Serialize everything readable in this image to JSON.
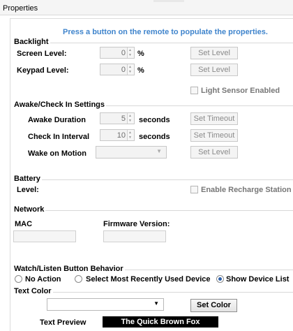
{
  "tab": {
    "title": "Properties"
  },
  "hint": "Press a button on the remote to populate the properties.",
  "backlight": {
    "title": "Backlight",
    "screen_label": "Screen Level:",
    "screen_value": "0",
    "screen_unit": "%",
    "keypad_label": "Keypad Level:",
    "keypad_value": "0",
    "keypad_unit": "%",
    "set_level_label": "Set Level",
    "light_sensor_label": "Light Sensor Enabled"
  },
  "awake": {
    "title": "Awake/Check In Settings",
    "awake_label": "Awake Duration",
    "awake_value": "5",
    "awake_unit": "seconds",
    "checkin_label": "Check In Interval",
    "checkin_value": "10",
    "checkin_unit": "seconds",
    "set_timeout_label": "Set Timeout",
    "wake_label": "Wake on Motion",
    "set_level_label": "Set Level"
  },
  "battery": {
    "title": "Battery",
    "level_label": "Level:",
    "recharge_label": "Enable Recharge Station"
  },
  "network": {
    "title": "Network",
    "mac_label": "MAC",
    "firmware_label": "Firmware Version:"
  },
  "watch": {
    "title": "Watch/Listen Button Behavior",
    "opt_none": "No Action",
    "opt_recent": "Select Most Recently Used Device",
    "opt_list": "Show Device List",
    "selected": "Show Device List"
  },
  "text_color": {
    "title": "Text Color",
    "set_color_label": "Set Color",
    "preview_label": "Text Preview",
    "preview_text": "The Quick Brown Fox"
  }
}
